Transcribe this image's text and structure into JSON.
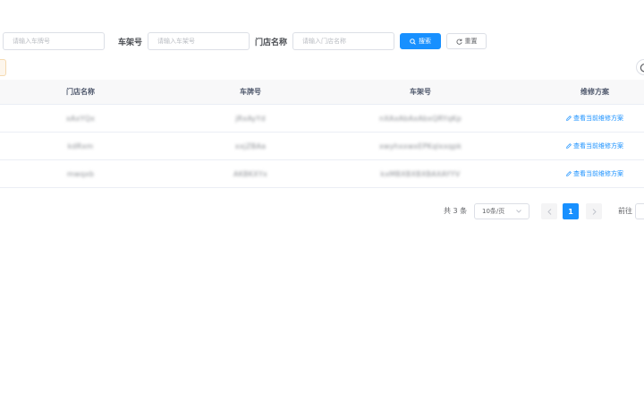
{
  "filters": {
    "plate": {
      "placeholder": "请输入车牌号"
    },
    "vin": {
      "label": "车架号",
      "placeholder": "请输入车架号"
    },
    "store": {
      "label": "门店名称",
      "placeholder": "请输入门店名称"
    },
    "search_label": "搜索",
    "reset_label": "重置"
  },
  "table": {
    "headers": [
      "门店名称",
      "车牌号",
      "车架号",
      "维修方案"
    ],
    "rows": [
      {
        "store": "xAxYQx",
        "plate": "jRxAyYd",
        "vin": "nXAxAbAxAbxQRYqKp",
        "action": "查看当前维修方案"
      },
      {
        "store": "kdRxm",
        "plate": "xxjZBAa",
        "vin": "xwyhxxwxEPKqlxxqpk",
        "action": "查看当前维修方案"
      },
      {
        "store": "mwqxb",
        "plate": "AKBKXYx",
        "vin": "kxMBXBXBXBAXAYYV",
        "action": "查看当前维修方案"
      }
    ]
  },
  "pagination": {
    "total_text": "共 3 条",
    "page_size": "10条/页",
    "current_page": "1",
    "goto_label": "前往"
  },
  "colors": {
    "primary": "#1890ff",
    "border": "#dcdfe6",
    "header_bg": "#f8f8f9"
  }
}
